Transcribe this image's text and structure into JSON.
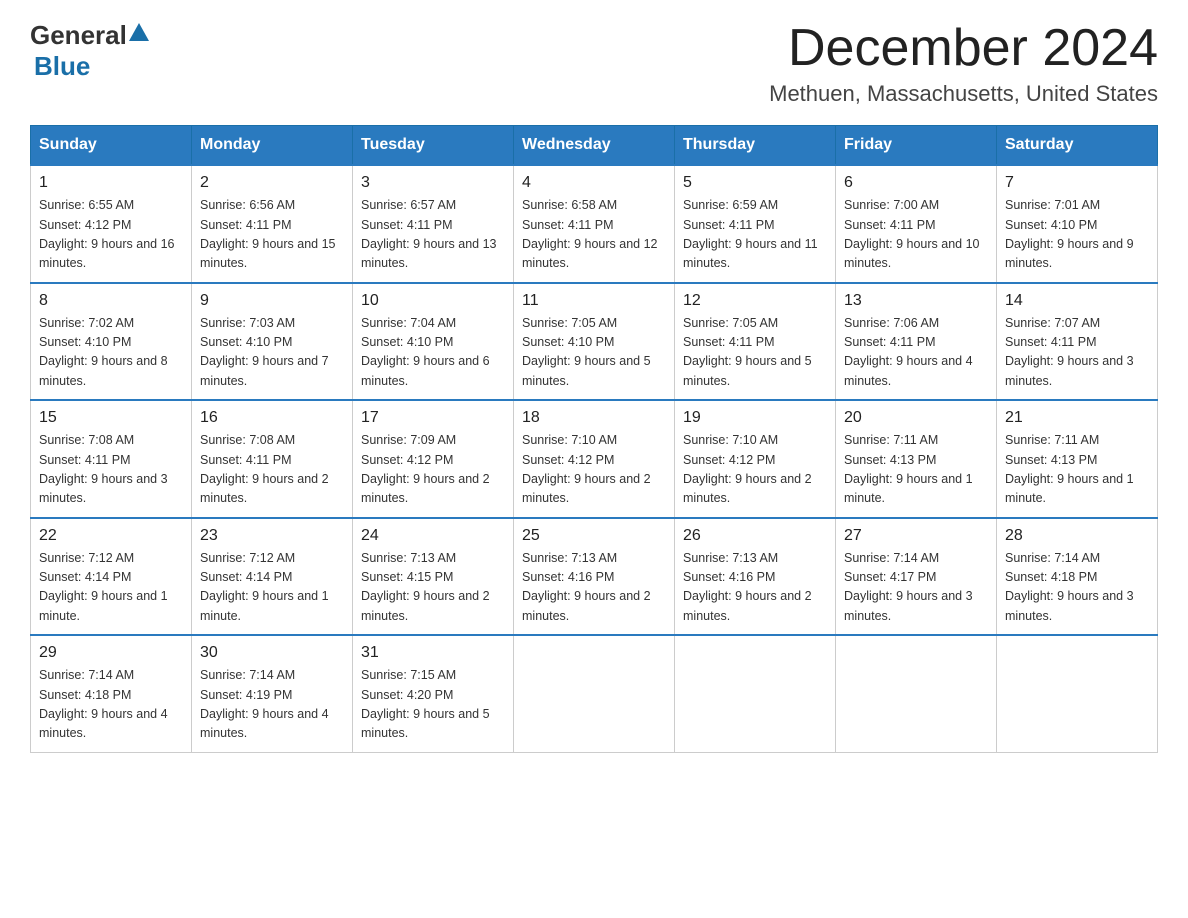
{
  "header": {
    "logo_general": "General",
    "logo_blue": "Blue",
    "month_title": "December 2024",
    "location": "Methuen, Massachusetts, United States"
  },
  "days_of_week": [
    "Sunday",
    "Monday",
    "Tuesday",
    "Wednesday",
    "Thursday",
    "Friday",
    "Saturday"
  ],
  "weeks": [
    [
      {
        "day": "1",
        "sunrise": "6:55 AM",
        "sunset": "4:12 PM",
        "daylight": "9 hours and 16 minutes."
      },
      {
        "day": "2",
        "sunrise": "6:56 AM",
        "sunset": "4:11 PM",
        "daylight": "9 hours and 15 minutes."
      },
      {
        "day": "3",
        "sunrise": "6:57 AM",
        "sunset": "4:11 PM",
        "daylight": "9 hours and 13 minutes."
      },
      {
        "day": "4",
        "sunrise": "6:58 AM",
        "sunset": "4:11 PM",
        "daylight": "9 hours and 12 minutes."
      },
      {
        "day": "5",
        "sunrise": "6:59 AM",
        "sunset": "4:11 PM",
        "daylight": "9 hours and 11 minutes."
      },
      {
        "day": "6",
        "sunrise": "7:00 AM",
        "sunset": "4:11 PM",
        "daylight": "9 hours and 10 minutes."
      },
      {
        "day": "7",
        "sunrise": "7:01 AM",
        "sunset": "4:10 PM",
        "daylight": "9 hours and 9 minutes."
      }
    ],
    [
      {
        "day": "8",
        "sunrise": "7:02 AM",
        "sunset": "4:10 PM",
        "daylight": "9 hours and 8 minutes."
      },
      {
        "day": "9",
        "sunrise": "7:03 AM",
        "sunset": "4:10 PM",
        "daylight": "9 hours and 7 minutes."
      },
      {
        "day": "10",
        "sunrise": "7:04 AM",
        "sunset": "4:10 PM",
        "daylight": "9 hours and 6 minutes."
      },
      {
        "day": "11",
        "sunrise": "7:05 AM",
        "sunset": "4:10 PM",
        "daylight": "9 hours and 5 minutes."
      },
      {
        "day": "12",
        "sunrise": "7:05 AM",
        "sunset": "4:11 PM",
        "daylight": "9 hours and 5 minutes."
      },
      {
        "day": "13",
        "sunrise": "7:06 AM",
        "sunset": "4:11 PM",
        "daylight": "9 hours and 4 minutes."
      },
      {
        "day": "14",
        "sunrise": "7:07 AM",
        "sunset": "4:11 PM",
        "daylight": "9 hours and 3 minutes."
      }
    ],
    [
      {
        "day": "15",
        "sunrise": "7:08 AM",
        "sunset": "4:11 PM",
        "daylight": "9 hours and 3 minutes."
      },
      {
        "day": "16",
        "sunrise": "7:08 AM",
        "sunset": "4:11 PM",
        "daylight": "9 hours and 2 minutes."
      },
      {
        "day": "17",
        "sunrise": "7:09 AM",
        "sunset": "4:12 PM",
        "daylight": "9 hours and 2 minutes."
      },
      {
        "day": "18",
        "sunrise": "7:10 AM",
        "sunset": "4:12 PM",
        "daylight": "9 hours and 2 minutes."
      },
      {
        "day": "19",
        "sunrise": "7:10 AM",
        "sunset": "4:12 PM",
        "daylight": "9 hours and 2 minutes."
      },
      {
        "day": "20",
        "sunrise": "7:11 AM",
        "sunset": "4:13 PM",
        "daylight": "9 hours and 1 minute."
      },
      {
        "day": "21",
        "sunrise": "7:11 AM",
        "sunset": "4:13 PM",
        "daylight": "9 hours and 1 minute."
      }
    ],
    [
      {
        "day": "22",
        "sunrise": "7:12 AM",
        "sunset": "4:14 PM",
        "daylight": "9 hours and 1 minute."
      },
      {
        "day": "23",
        "sunrise": "7:12 AM",
        "sunset": "4:14 PM",
        "daylight": "9 hours and 1 minute."
      },
      {
        "day": "24",
        "sunrise": "7:13 AM",
        "sunset": "4:15 PM",
        "daylight": "9 hours and 2 minutes."
      },
      {
        "day": "25",
        "sunrise": "7:13 AM",
        "sunset": "4:16 PM",
        "daylight": "9 hours and 2 minutes."
      },
      {
        "day": "26",
        "sunrise": "7:13 AM",
        "sunset": "4:16 PM",
        "daylight": "9 hours and 2 minutes."
      },
      {
        "day": "27",
        "sunrise": "7:14 AM",
        "sunset": "4:17 PM",
        "daylight": "9 hours and 3 minutes."
      },
      {
        "day": "28",
        "sunrise": "7:14 AM",
        "sunset": "4:18 PM",
        "daylight": "9 hours and 3 minutes."
      }
    ],
    [
      {
        "day": "29",
        "sunrise": "7:14 AM",
        "sunset": "4:18 PM",
        "daylight": "9 hours and 4 minutes."
      },
      {
        "day": "30",
        "sunrise": "7:14 AM",
        "sunset": "4:19 PM",
        "daylight": "9 hours and 4 minutes."
      },
      {
        "day": "31",
        "sunrise": "7:15 AM",
        "sunset": "4:20 PM",
        "daylight": "9 hours and 5 minutes."
      },
      null,
      null,
      null,
      null
    ]
  ]
}
